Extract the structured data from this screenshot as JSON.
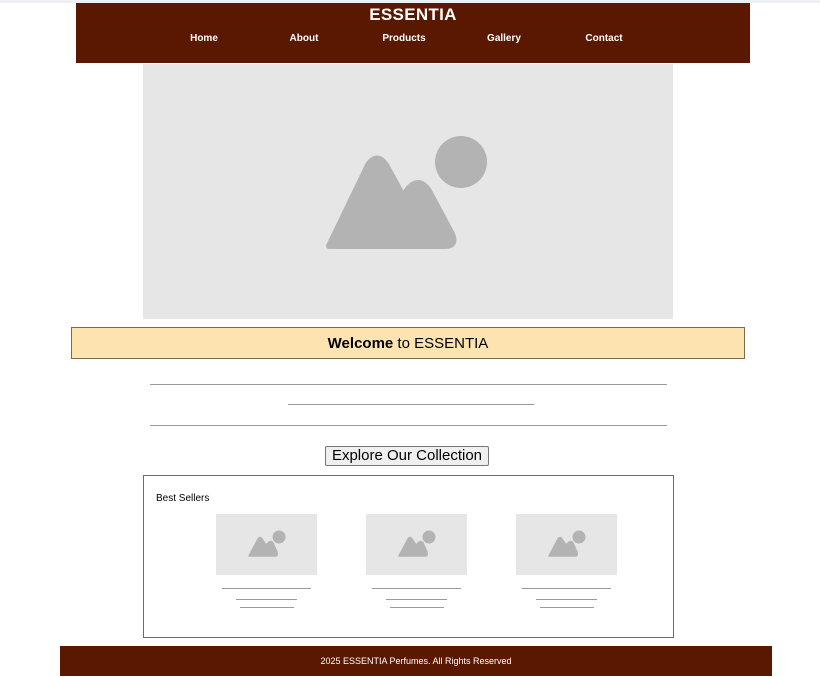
{
  "header": {
    "brand": "ESSENTIA",
    "nav": [
      "Home",
      "About",
      "Products",
      "Gallery",
      "Contact"
    ]
  },
  "hero": {
    "image_icon": "image-placeholder-icon"
  },
  "welcome": {
    "bold": "Welcome",
    "rest": " to ESSENTIA"
  },
  "cta": {
    "label": "Explore Our Collection"
  },
  "best_sellers": {
    "title": "Best Sellers",
    "items": [
      {
        "image_icon": "image-placeholder-icon"
      },
      {
        "image_icon": "image-placeholder-icon"
      },
      {
        "image_icon": "image-placeholder-icon"
      }
    ]
  },
  "footer": {
    "text": "2025 ESSENTIA Perfumes. All Rights Reserved"
  },
  "colors": {
    "brand_brown": "#5a1800",
    "welcome_bg": "#fde3b0",
    "placeholder_bg": "#e6e6e6",
    "placeholder_shape": "#b3b3b3"
  }
}
